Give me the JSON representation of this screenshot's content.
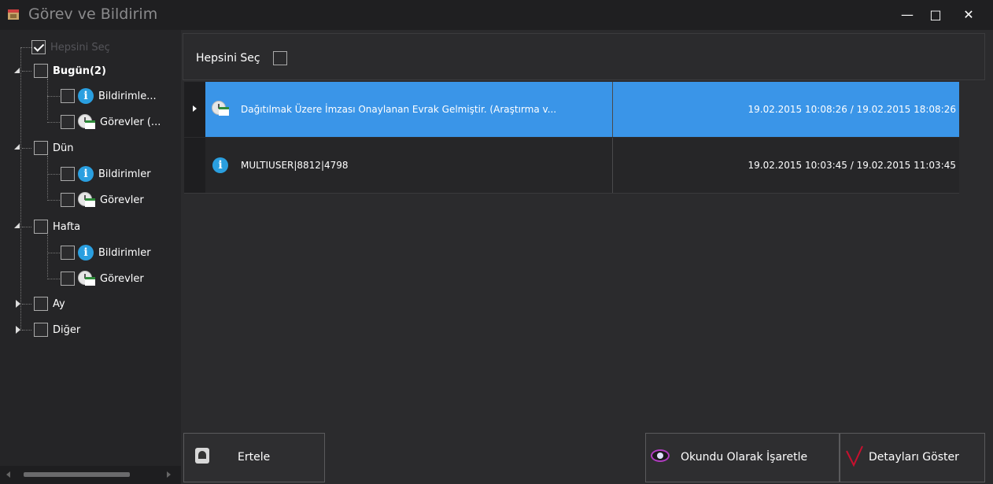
{
  "window": {
    "title": "Görev ve Bildirim",
    "minimize_glyph": "—",
    "maximize_glyph": "□",
    "close_glyph": "✕"
  },
  "tree": {
    "select_all_label": "Hepsini Seç",
    "groups": [
      {
        "label": "Bugün(2)",
        "children": [
          "Bildirimle...",
          "Görevler (..."
        ]
      },
      {
        "label": "Dün",
        "children": [
          "Bildirimler",
          "Görevler"
        ]
      },
      {
        "label": "Hafta",
        "children": [
          "Bildirimler",
          "Görevler"
        ]
      },
      {
        "label": "Ay"
      },
      {
        "label": "Diğer"
      }
    ]
  },
  "header": {
    "select_all_label": "Hepsini Seç"
  },
  "rows": [
    {
      "icon": "task-icon",
      "message": "Dağıtılmak Üzere İmzası Onaylanan Evrak Gelmiştir. (Araştırma v...",
      "dates": "19.02.2015 10:08:26 / 19.02.2015 18:08:26",
      "selected": true
    },
    {
      "icon": "info-icon",
      "message": "MULTIUSER|8812|4798",
      "dates": "19.02.2015 10:03:45 / 19.02.2015 11:03:45",
      "selected": false
    }
  ],
  "buttons": {
    "postpone": "Ertele",
    "mark_read": "Okundu Olarak İşaretle",
    "show_details": "Detayları Göster"
  },
  "colors": {
    "selection": "#3a95e8",
    "info": "#2a9fe0",
    "eye": "#b03cc0",
    "details_check": "#c8102e"
  }
}
